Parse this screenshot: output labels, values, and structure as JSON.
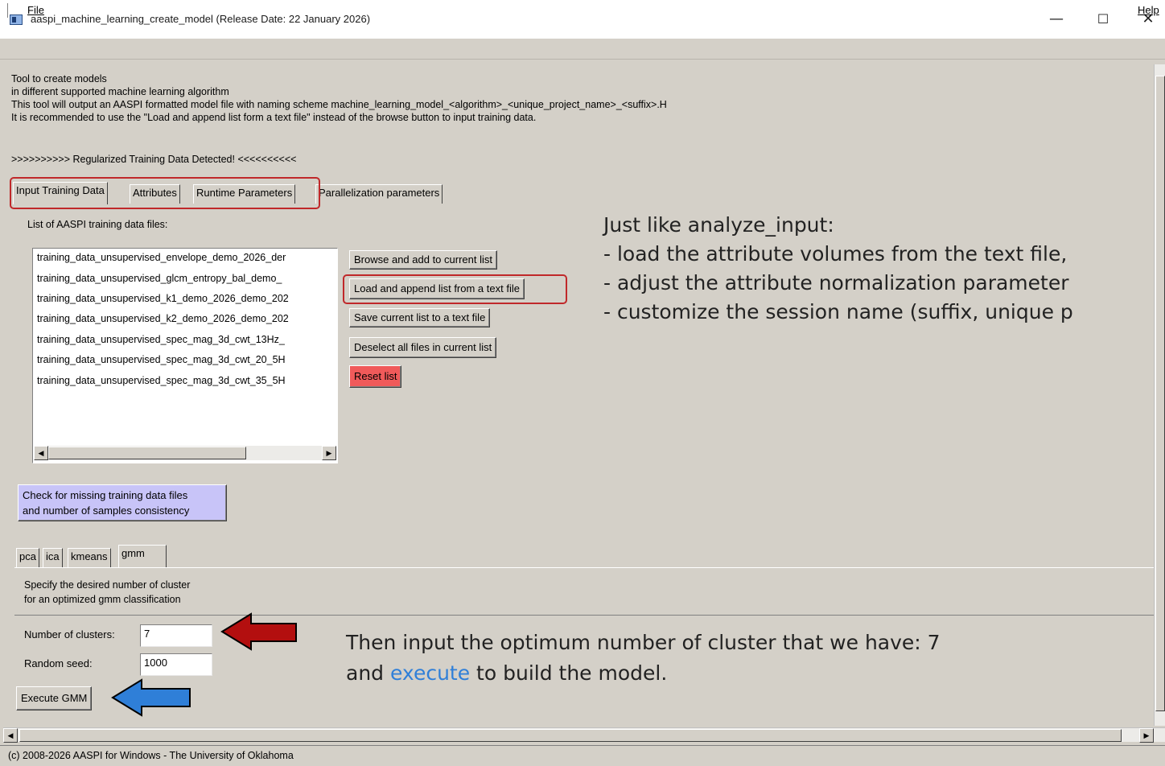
{
  "window": {
    "title": "aaspi_machine_learning_create_model (Release Date: 22 January 2026)",
    "minimize": "—",
    "maximize": "☐",
    "close": "✕"
  },
  "menubar": {
    "file": "File",
    "help": "Help"
  },
  "description": [
    "Tool to create models",
    "in different supported machine learning algorithm",
    "This tool will output an AASPI formatted model file with naming scheme machine_learning_model_<algorithm>_<unique_project_name>_<suffix>.H",
    "It is recommended to use the \"Load and append list form a text file\" instead of the browse button to input training data."
  ],
  "detected_banner": ">>>>>>>>>> Regularized Training Data Detected! <<<<<<<<<<",
  "main_tabs": [
    {
      "label": "Input Training Data",
      "active": true
    },
    {
      "label": "Attributes",
      "active": false
    },
    {
      "label": "Runtime Parameters",
      "active": false
    },
    {
      "label": "Parallelization parameters",
      "active": false
    }
  ],
  "training_list": {
    "heading": "List of AASPI training data files:",
    "items": [
      "training_data_unsupervised_envelope_demo_2026_der",
      "training_data_unsupervised_glcm_entropy_bal_demo_",
      "training_data_unsupervised_k1_demo_2026_demo_202",
      "training_data_unsupervised_k2_demo_2026_demo_202",
      "training_data_unsupervised_spec_mag_3d_cwt_13Hz_",
      "training_data_unsupervised_spec_mag_3d_cwt_20_5H",
      "training_data_unsupervised_spec_mag_3d_cwt_35_5H"
    ],
    "scroll_left": "◀",
    "scroll_right": "▶"
  },
  "list_buttons": {
    "browse": "Browse and add to current list",
    "load": "Load and append list from a text file",
    "save": "Save current list to a text file",
    "deselect": "Deselect all files in current list",
    "reset": "Reset list"
  },
  "check_button": [
    "Check for missing training data files",
    "and number of samples consistency"
  ],
  "algo_tabs": [
    {
      "label": "pca",
      "active": false
    },
    {
      "label": "ica",
      "active": false
    },
    {
      "label": "kmeans",
      "active": false
    },
    {
      "label": "gmm",
      "active": true
    }
  ],
  "gmm": {
    "description": [
      "Specify the desired number of cluster",
      "for an optimized gmm classification"
    ],
    "clusters_label": "Number of clusters:",
    "clusters_value": "7",
    "seed_label": "Random seed:",
    "seed_value": "1000",
    "execute": "Execute GMM"
  },
  "annotation_top": {
    "line1": "Just like analyze_input:",
    "line2": "- load the attribute volumes from the text file,",
    "line3": "- adjust the attribute normalization parameter",
    "line4": "- customize the session name (suffix, unique p"
  },
  "annotation_bottom": {
    "line1": "Then input the optimum number of cluster that we have: 7",
    "line2_before": "and ",
    "line2_highlight": "execute",
    "line2_after": " to build the model."
  },
  "status": "(c) 2008-2026 AASPI for Windows - The University of Oklahoma",
  "colors": {
    "highlight_box": "#c0282a",
    "reset_button": "#f05a5a",
    "check_button": "#c8c4f8",
    "red_arrow": "#b30f0f",
    "blue_arrow": "#2f7fd8",
    "execute_text": "#2f7fd8"
  }
}
